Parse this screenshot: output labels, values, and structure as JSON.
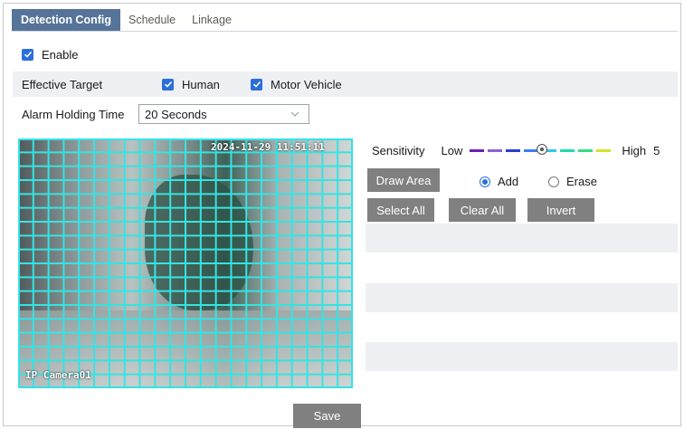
{
  "tabs": [
    "Detection Config",
    "Schedule",
    "Linkage"
  ],
  "enable": {
    "label": "Enable",
    "checked": true
  },
  "effective_target": {
    "label": "Effective Target",
    "options": [
      {
        "label": "Human",
        "checked": true
      },
      {
        "label": "Motor Vehicle",
        "checked": true
      }
    ]
  },
  "alarm_holding": {
    "label": "Alarm Holding Time",
    "value": "20 Seconds"
  },
  "video": {
    "timestamp": "2024-11-29 11:51:11",
    "camera_name": "IP Camera01"
  },
  "sensitivity": {
    "label": "Sensitivity",
    "low": "Low",
    "high": "High",
    "value": "5",
    "level_fraction": 0.5
  },
  "area": {
    "draw_area": "Draw Area",
    "mode": {
      "add": "Add",
      "erase": "Erase",
      "selected": "add"
    },
    "select_all": "Select All",
    "clear_all": "Clear All",
    "invert": "Invert"
  },
  "save": "Save",
  "colors": {
    "accent": "#2b6fdc",
    "tab_active": "#56749a",
    "button": "#808080",
    "grid": "#36e3e3"
  }
}
